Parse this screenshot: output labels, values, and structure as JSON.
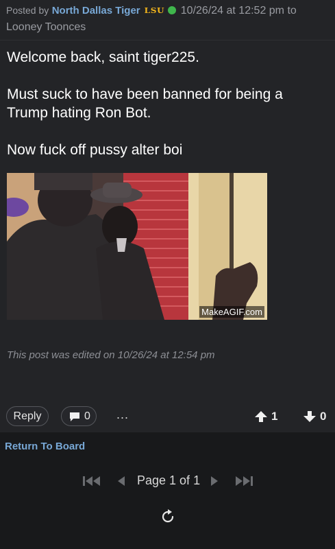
{
  "post": {
    "posted_by_prefix": "Posted by",
    "author": "North Dallas Tiger",
    "school_badge": "LSU",
    "timestamp": "10/26/24 at 12:52 pm to",
    "reply_to": "Looney Toonces",
    "body_lines": [
      "Welcome back, saint tiger225.",
      "Must suck to have been banned for being a",
      "Trump hating Ron Bot.",
      "Now fuck off pussy alter boi"
    ],
    "gif_watermark": "MakeAGIF.com",
    "edited_note": "This post was edited on 10/26/24 at 12:54 pm"
  },
  "actions": {
    "reply_label": "Reply",
    "comment_count": "0",
    "more_label": "...",
    "upvotes": "1",
    "downvotes": "0"
  },
  "footer": {
    "return_label": "Return To Board",
    "page_label": "Page 1 of 1"
  },
  "colors": {
    "background": "#232427",
    "footer_background": "#18191b",
    "link": "#78a8d6",
    "online": "#3fb64c",
    "school_badge": "#f2b51c"
  },
  "icons": [
    "online-status-icon",
    "comment-icon",
    "more-icon",
    "upvote-arrow-icon",
    "downvote-arrow-icon",
    "first-page-icon",
    "prev-page-icon",
    "next-page-icon",
    "last-page-icon",
    "refresh-icon"
  ]
}
